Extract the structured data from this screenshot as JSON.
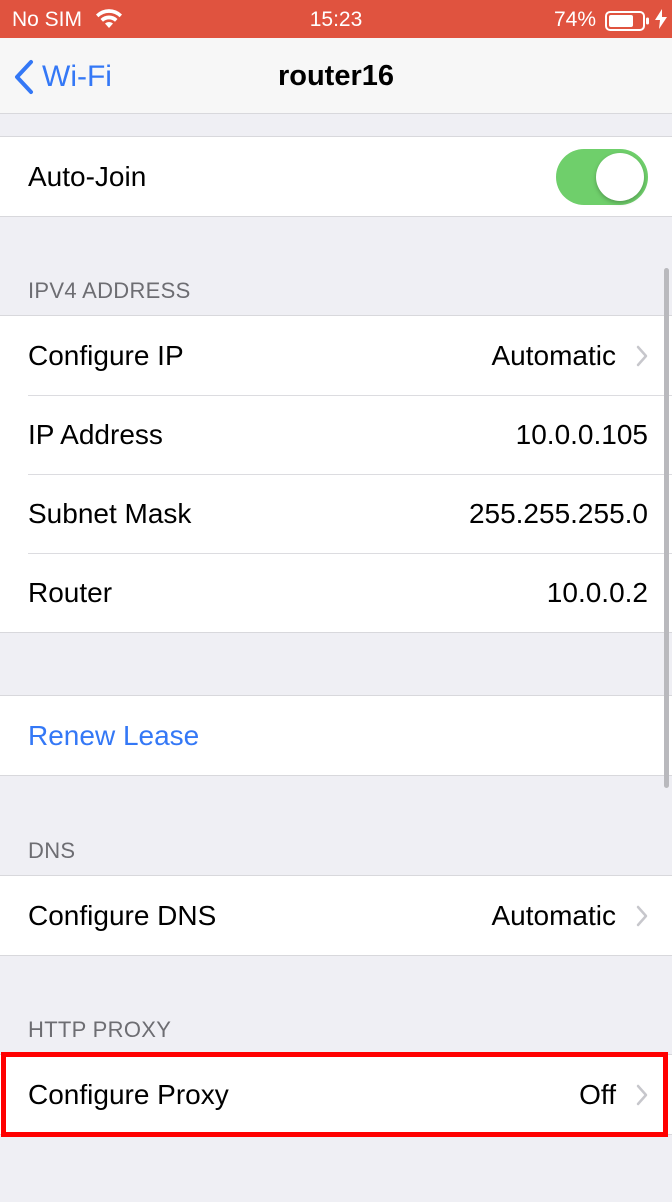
{
  "status_bar": {
    "carrier": "No SIM",
    "time": "15:23",
    "battery_percent": "74%",
    "icons": [
      "wifi-icon",
      "battery-icon",
      "charging-bolt-icon"
    ]
  },
  "nav": {
    "back_label": "Wi-Fi",
    "title": "router16"
  },
  "auto_join": {
    "label": "Auto-Join",
    "enabled": true
  },
  "ipv4": {
    "header": "IPV4 ADDRESS",
    "rows": [
      {
        "label": "Configure IP",
        "value": "Automatic"
      },
      {
        "label": "IP Address",
        "value": "10.0.0.105"
      },
      {
        "label": "Subnet Mask",
        "value": "255.255.255.0"
      },
      {
        "label": "Router",
        "value": "10.0.0.2"
      }
    ]
  },
  "renew": {
    "label": "Renew Lease"
  },
  "dns": {
    "header": "DNS",
    "label": "Configure DNS",
    "value": "Automatic"
  },
  "proxy": {
    "header": "HTTP PROXY",
    "label": "Configure Proxy",
    "value": "Off"
  },
  "colors": {
    "status_bar": "#e0533f",
    "accent": "#3478f6",
    "toggle_on": "#6fcf6b",
    "highlight": "#ff0000"
  }
}
